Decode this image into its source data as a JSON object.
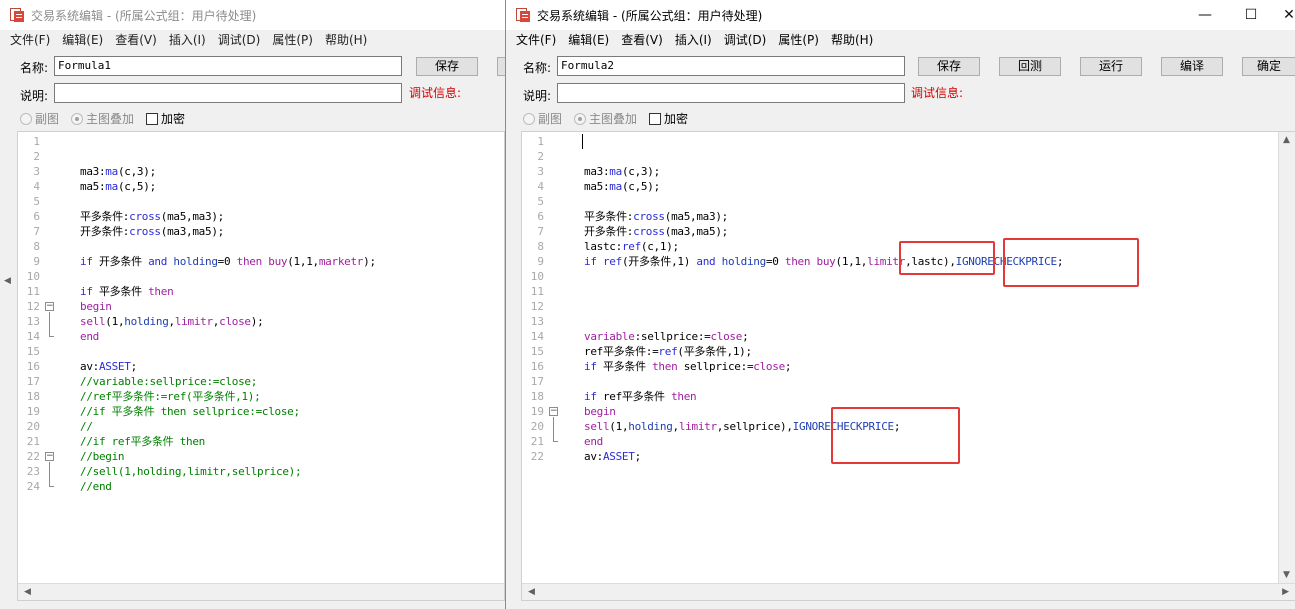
{
  "windows": [
    {
      "id": "win1",
      "title": "交易系统编辑 - (所属公式组：用户待处理)",
      "menu": [
        "文件(F)",
        "编辑(E)",
        "查看(V)",
        "插入(I)",
        "调试(D)",
        "属性(P)",
        "帮助(H)"
      ],
      "name_label": "名称:",
      "name_value": "Formula1",
      "desc_label": "说明:",
      "desc_value": "",
      "debug_label": "调试信息:",
      "buttons": [
        "保存"
      ],
      "options": {
        "sub": "副图",
        "main": "主图叠加",
        "encrypt": "加密"
      },
      "code_lines": [
        [],
        [],
        [
          [
            "t",
            "ma3:"
          ],
          [
            "k",
            "ma"
          ],
          [
            "t",
            "(c,3);"
          ]
        ],
        [
          [
            "t",
            "ma5:"
          ],
          [
            "k",
            "ma"
          ],
          [
            "t",
            "(c,5);"
          ]
        ],
        [],
        [
          [
            "t",
            "平多条件:"
          ],
          [
            "k",
            "cross"
          ],
          [
            "t",
            "(ma5,ma3);"
          ]
        ],
        [
          [
            "t",
            "开多条件:"
          ],
          [
            "k",
            "cross"
          ],
          [
            "t",
            "(ma3,ma5);"
          ]
        ],
        [],
        [
          [
            "k",
            "if"
          ],
          [
            "t",
            " 开多条件 "
          ],
          [
            "k",
            "and"
          ],
          [
            "t",
            " "
          ],
          [
            "v",
            "holding"
          ],
          [
            "t",
            "=0 "
          ],
          [
            "p",
            "then"
          ],
          [
            "t",
            " "
          ],
          [
            "p",
            "buy"
          ],
          [
            "t",
            "(1,1,"
          ],
          [
            "p",
            "marketr"
          ],
          [
            "t",
            ");"
          ]
        ],
        [],
        [
          [
            "k",
            "if"
          ],
          [
            "t",
            " 平多条件 "
          ],
          [
            "p",
            "then"
          ]
        ],
        [
          [
            "p",
            "begin"
          ]
        ],
        [
          [
            "p",
            "sell"
          ],
          [
            "t",
            "(1,"
          ],
          [
            "v",
            "holding"
          ],
          [
            "t",
            ","
          ],
          [
            "p",
            "limitr"
          ],
          [
            "t",
            ","
          ],
          [
            "p",
            "close"
          ],
          [
            "t",
            ");"
          ]
        ],
        [
          [
            "p",
            "end"
          ]
        ],
        [],
        [
          [
            "t",
            "av:"
          ],
          [
            "k",
            "ASSET"
          ],
          [
            "t",
            ";"
          ]
        ],
        [
          [
            "c",
            "//variable:sellprice:=close;"
          ]
        ],
        [
          [
            "c",
            "//ref平多条件:=ref(平多条件,1);"
          ]
        ],
        [
          [
            "c",
            "//if 平多条件 then sellprice:=close;"
          ]
        ],
        [
          [
            "c",
            "//"
          ]
        ],
        [
          [
            "c",
            "//if ref平多条件 then"
          ]
        ],
        [
          [
            "c",
            "//begin"
          ]
        ],
        [
          [
            "c",
            "//sell(1,holding,limitr,sellprice);"
          ]
        ],
        [
          [
            "c",
            "//end"
          ]
        ]
      ]
    },
    {
      "id": "win2",
      "title": "交易系统编辑 - (所属公式组：用户待处理)",
      "menu": [
        "文件(F)",
        "编辑(E)",
        "查看(V)",
        "插入(I)",
        "调试(D)",
        "属性(P)",
        "帮助(H)"
      ],
      "name_label": "名称:",
      "name_value": "Formula2",
      "desc_label": "说明:",
      "desc_value": "",
      "debug_label": "调试信息:",
      "buttons": [
        "保存",
        "回测",
        "运行",
        "编译",
        "确定"
      ],
      "options": {
        "sub": "副图",
        "main": "主图叠加",
        "encrypt": "加密"
      },
      "code_lines": [
        [],
        [],
        [
          [
            "t",
            "ma3:"
          ],
          [
            "k",
            "ma"
          ],
          [
            "t",
            "(c,3);"
          ]
        ],
        [
          [
            "t",
            "ma5:"
          ],
          [
            "k",
            "ma"
          ],
          [
            "t",
            "(c,5);"
          ]
        ],
        [],
        [
          [
            "t",
            "平多条件:"
          ],
          [
            "k",
            "cross"
          ],
          [
            "t",
            "(ma5,ma3);"
          ]
        ],
        [
          [
            "t",
            "开多条件:"
          ],
          [
            "k",
            "cross"
          ],
          [
            "t",
            "(ma3,ma5);"
          ]
        ],
        [
          [
            "t",
            "lastc:"
          ],
          [
            "k",
            "ref"
          ],
          [
            "t",
            "(c,1);"
          ]
        ],
        [
          [
            "k",
            "if"
          ],
          [
            "t",
            " "
          ],
          [
            "k",
            "ref"
          ],
          [
            "t",
            "(开多条件,1) "
          ],
          [
            "k",
            "and"
          ],
          [
            "t",
            " "
          ],
          [
            "v",
            "holding"
          ],
          [
            "t",
            "=0 "
          ],
          [
            "p",
            "then"
          ],
          [
            "t",
            " "
          ],
          [
            "p",
            "buy"
          ],
          [
            "t",
            "(1,1,"
          ],
          [
            "p",
            "limitr"
          ],
          [
            "t",
            ",lastc),"
          ],
          [
            "v",
            "IGNORECHECKPRICE"
          ],
          [
            "t",
            ";"
          ]
        ],
        [],
        [],
        [],
        [],
        [
          [
            "p",
            "variable"
          ],
          [
            "t",
            ":sellprice:="
          ],
          [
            "p",
            "close"
          ],
          [
            "t",
            ";"
          ]
        ],
        [
          [
            "t",
            "ref平多条件:="
          ],
          [
            "k",
            "ref"
          ],
          [
            "t",
            "(平多条件,1);"
          ]
        ],
        [
          [
            "k",
            "if"
          ],
          [
            "t",
            " 平多条件 "
          ],
          [
            "p",
            "then"
          ],
          [
            "t",
            " sellprice:="
          ],
          [
            "p",
            "close"
          ],
          [
            "t",
            ";"
          ]
        ],
        [],
        [
          [
            "k",
            "if"
          ],
          [
            "t",
            " ref平多条件 "
          ],
          [
            "p",
            "then"
          ]
        ],
        [
          [
            "p",
            "begin"
          ]
        ],
        [
          [
            "p",
            "sell"
          ],
          [
            "t",
            "(1,"
          ],
          [
            "v",
            "holding"
          ],
          [
            "t",
            ","
          ],
          [
            "p",
            "limitr"
          ],
          [
            "t",
            ",sellprice),"
          ],
          [
            "v",
            "IGNORECHECKPRICE"
          ],
          [
            "t",
            ";"
          ]
        ],
        [
          [
            "p",
            "end"
          ]
        ],
        [
          [
            "t",
            "av:"
          ],
          [
            "k",
            "ASSET"
          ],
          [
            "t",
            ";"
          ]
        ]
      ]
    }
  ],
  "colors": {
    "highlight": "#e23a3a",
    "debug": "#d40000"
  },
  "icons": [
    "app-icon",
    "minimize-icon",
    "maximize-icon",
    "close-icon",
    "scroll-arrow-icons"
  ]
}
